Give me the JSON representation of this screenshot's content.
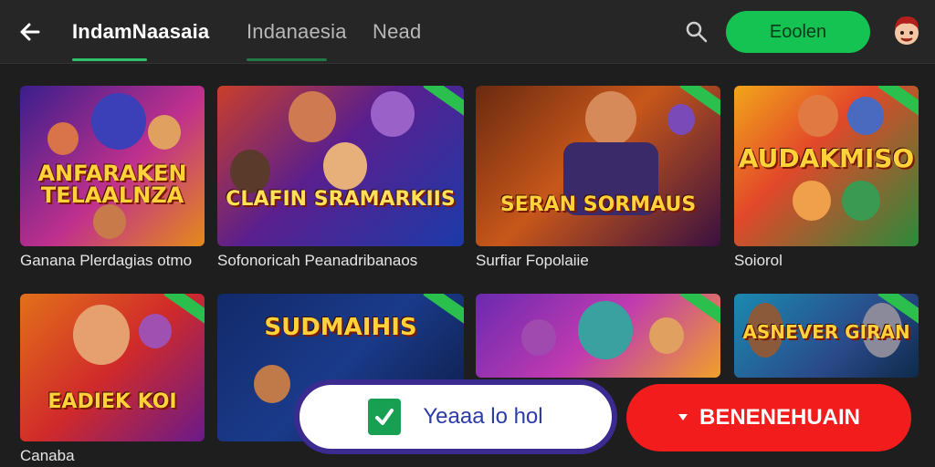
{
  "header": {
    "tabs": [
      {
        "label": "IndamNaasaia",
        "active": true
      },
      {
        "label": "Indanaesia",
        "active": false
      },
      {
        "label": "Nead",
        "active": false
      }
    ],
    "login_label": "Eoolen",
    "icons": [
      "back-arrow-icon",
      "search-icon",
      "avatar-icon"
    ]
  },
  "games": [
    {
      "art_text": "ANFARAKEN TELAALNZA",
      "caption": "Ganana Plerdagias otmo"
    },
    {
      "art_text": "CLAFIN SRAMARKIIS",
      "caption": "Sofonoricah Peanadribanaos"
    },
    {
      "art_text": "SERAN SORMAUS",
      "caption": "Surfiar Fopolaiie"
    },
    {
      "art_text": "AUDAKMISO",
      "caption": "Soiorol"
    },
    {
      "art_text": "EADIEK KOI",
      "caption": "Canaba"
    },
    {
      "art_text": "SUDMAIHIS",
      "caption": ""
    },
    {
      "art_text": "",
      "caption": ""
    },
    {
      "art_text": "ASNEVER GIRAN",
      "caption": ""
    }
  ],
  "cta": {
    "secondary_label": "Yeaaa lo hol",
    "primary_label": "BENENEHUAIN"
  },
  "colors": {
    "accent_green": "#14c351",
    "cta_red": "#f21c1c",
    "background": "#1e1e1e"
  }
}
